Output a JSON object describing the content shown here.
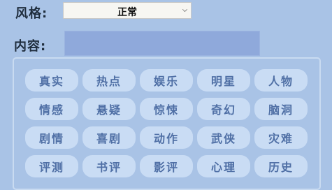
{
  "form": {
    "style_label": "风格:",
    "style_value": "正常",
    "content_label": "内容:",
    "content_value": ""
  },
  "tags": [
    "真实",
    "热点",
    "娱乐",
    "明星",
    "人物",
    "情感",
    "悬疑",
    "惊悚",
    "奇幻",
    "脑洞",
    "剧情",
    "喜剧",
    "动作",
    "武侠",
    "灾难",
    "评测",
    "书评",
    "影评",
    "心理",
    "历史"
  ]
}
